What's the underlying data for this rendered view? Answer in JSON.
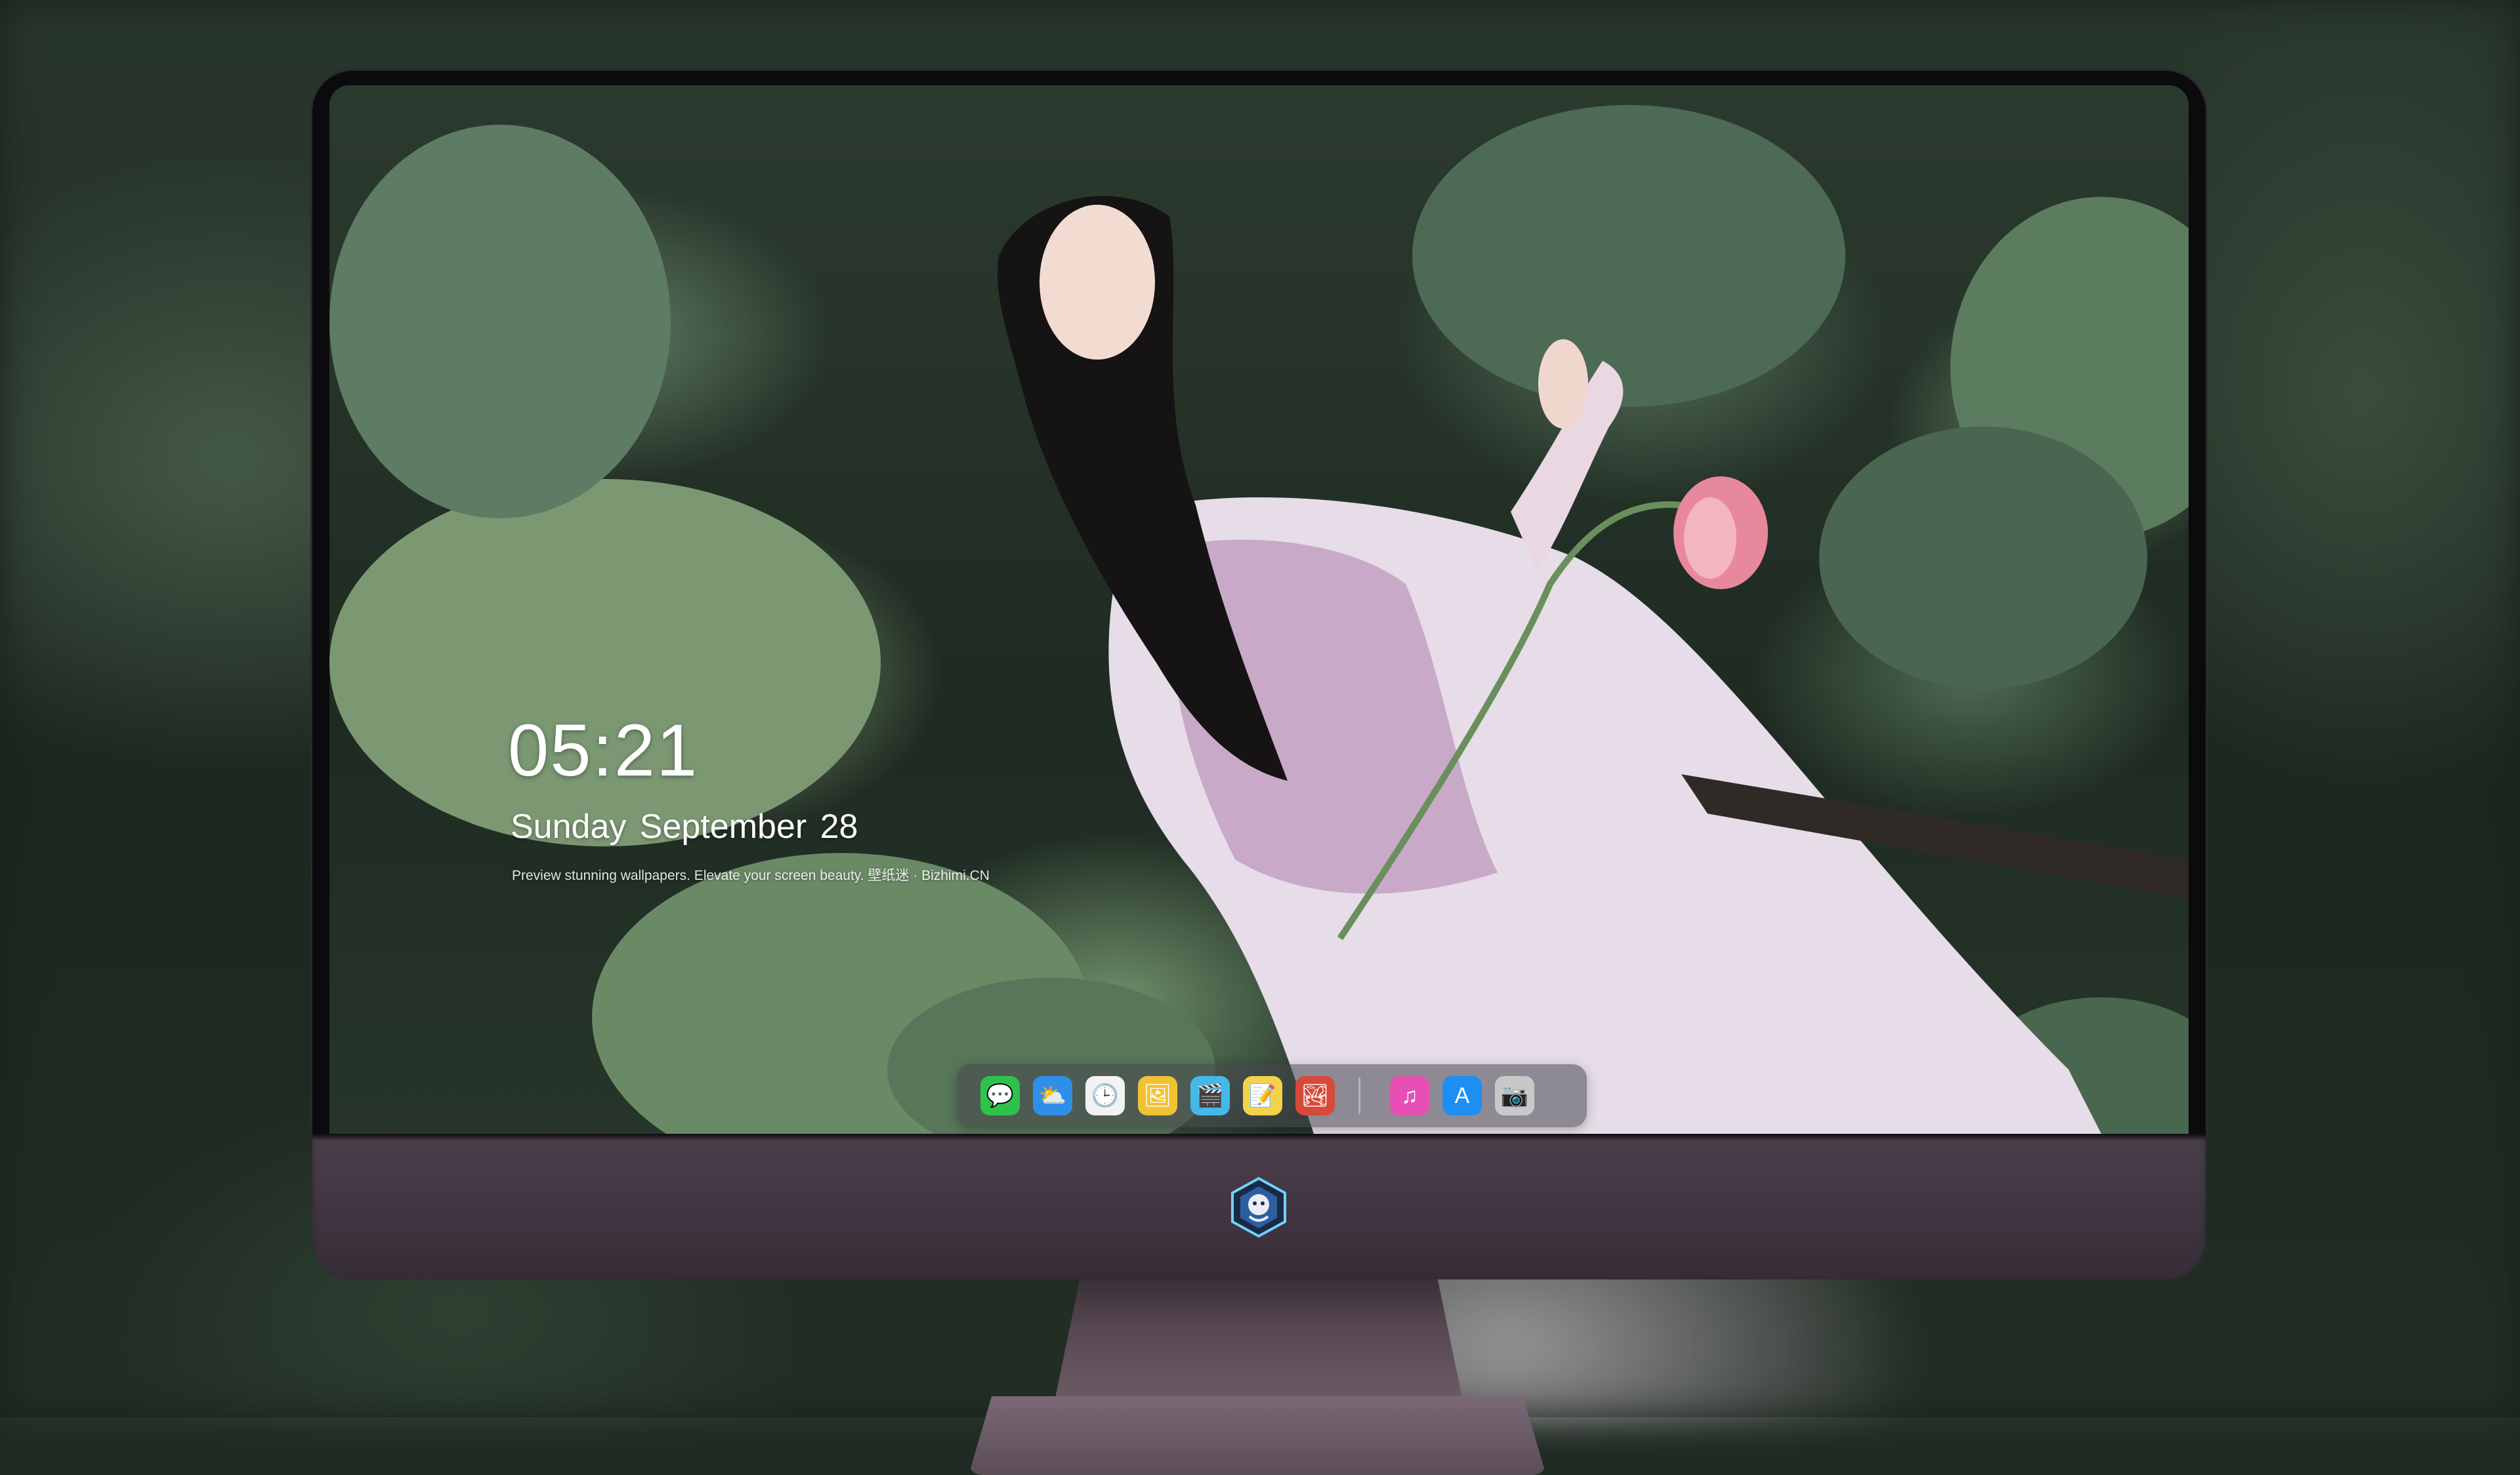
{
  "lock_screen": {
    "time": "05:21",
    "date": "Sunday September  28",
    "caption": "Preview stunning wallpapers. Elevate your screen beauty. 壁纸迷 · Bizhimi.CN"
  },
  "dock": {
    "apps": [
      {
        "name": "messages-icon",
        "glyph": "💬",
        "color": "#2fc24b"
      },
      {
        "name": "weather-icon",
        "glyph": "⛅",
        "color": "#2f8fe8"
      },
      {
        "name": "clock-icon",
        "glyph": "🕒",
        "color": "#f2f2f2"
      },
      {
        "name": "preview-icon",
        "glyph": "🖼",
        "color": "#f1c232"
      },
      {
        "name": "clips-icon",
        "glyph": "🎬",
        "color": "#46b8e8"
      },
      {
        "name": "notes-icon",
        "glyph": "📝",
        "color": "#f6d24a"
      },
      {
        "name": "photo-booth-icon",
        "glyph": "🏞",
        "color": "#d64a3a"
      },
      {
        "name": "music-icon",
        "glyph": "♫",
        "color": "#e84fb5"
      },
      {
        "name": "app-store-icon",
        "glyph": "A",
        "color": "#1d8ff2"
      },
      {
        "name": "camera-icon",
        "glyph": "📷",
        "color": "#c8c8c8"
      }
    ]
  },
  "colors": {
    "accent": "#ffffff",
    "chin": "#4a3f4b"
  }
}
